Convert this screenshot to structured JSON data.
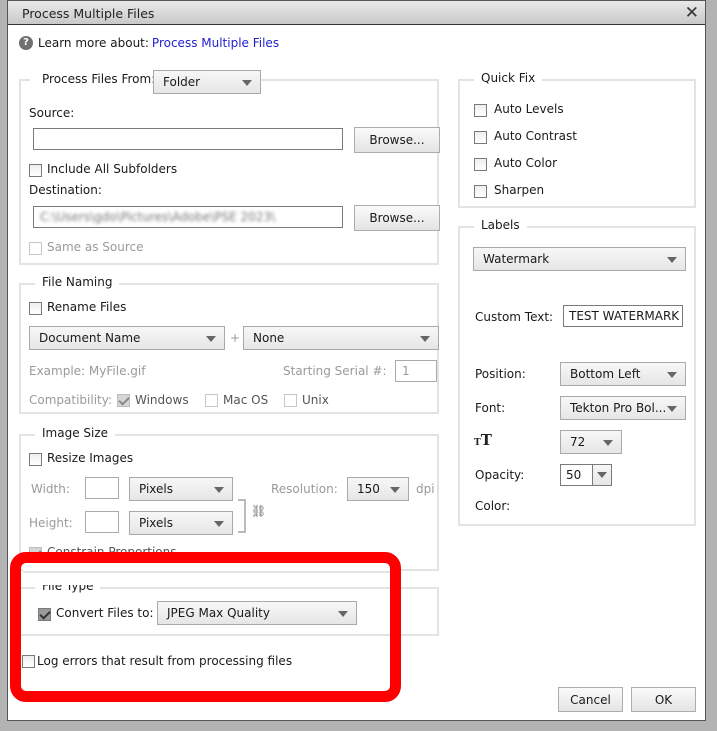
{
  "window": {
    "title": "Process Multiple Files",
    "close_icon": "close-x-icon"
  },
  "help": {
    "icon": "help-question-icon",
    "label": "Learn more about:",
    "link": "Process Multiple Files"
  },
  "process_from": {
    "legend": "Process Files From:",
    "selected": "Folder",
    "source_label": "Source:",
    "source_value": "",
    "browse_label": "Browse...",
    "include_subfolders": {
      "label": "Include All Subfolders",
      "checked": false
    },
    "destination_label": "Destination:",
    "destination_value": "C:\\Users\\gdo\\Pictures\\Adobe\\PSE 2023\\",
    "same_as_source": {
      "label": "Same as Source",
      "checked": false,
      "disabled": true
    }
  },
  "file_naming": {
    "legend": "File Naming",
    "rename": {
      "label": "Rename Files",
      "checked": false
    },
    "name_part1": "Document Name",
    "plus": "+",
    "name_part2": "None",
    "example": "Example: MyFile.gif",
    "serial_label": "Starting Serial #:",
    "serial_value": "1",
    "compat_label": "Compatibility:",
    "compat": [
      {
        "label": "Windows",
        "checked": true
      },
      {
        "label": "Mac OS",
        "checked": false
      },
      {
        "label": "Unix",
        "checked": false
      }
    ]
  },
  "image_size": {
    "legend": "Image Size",
    "resize": {
      "label": "Resize Images",
      "checked": false
    },
    "width_label": "Width:",
    "width_value": "",
    "width_unit": "Pixels",
    "height_label": "Height:",
    "height_value": "",
    "height_unit": "Pixels",
    "resolution_label": "Resolution:",
    "resolution_value": "150",
    "resolution_unit": "dpi",
    "constrain": {
      "label": "Constrain Proportions",
      "checked": true
    },
    "link_icon": "chain-link-icon"
  },
  "file_type": {
    "legend": "File Type",
    "convert": {
      "label": "Convert Files to:",
      "checked": true
    },
    "format": "JPEG Max Quality"
  },
  "log_errors": {
    "label": "Log errors that result from processing files",
    "checked": false
  },
  "quick_fix": {
    "legend": "Quick Fix",
    "items": [
      {
        "label": "Auto Levels",
        "checked": false
      },
      {
        "label": "Auto Contrast",
        "checked": false
      },
      {
        "label": "Auto Color",
        "checked": false
      },
      {
        "label": "Sharpen",
        "checked": false
      }
    ]
  },
  "labels": {
    "legend": "Labels",
    "type": "Watermark",
    "custom_text_label": "Custom Text:",
    "custom_text_value": "TEST WATERMARK",
    "position_label": "Position:",
    "position_value": "Bottom Left",
    "font_label": "Font:",
    "font_value": "Tekton Pro Bol...",
    "font_size_icon": "text-size-icon",
    "font_size_value": "72",
    "opacity_label": "Opacity:",
    "opacity_value": "50",
    "color_label": "Color:"
  },
  "buttons": {
    "cancel": "Cancel",
    "ok": "OK"
  },
  "annotation": {
    "highlight_color": "#ff0000"
  }
}
